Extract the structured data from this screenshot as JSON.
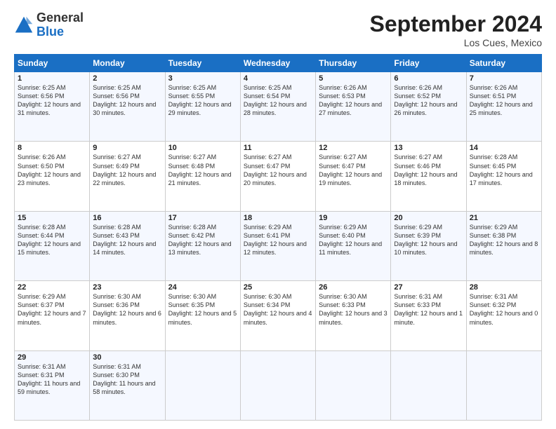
{
  "header": {
    "logo_general": "General",
    "logo_blue": "Blue",
    "month_title": "September 2024",
    "location": "Los Cues, Mexico"
  },
  "days_of_week": [
    "Sunday",
    "Monday",
    "Tuesday",
    "Wednesday",
    "Thursday",
    "Friday",
    "Saturday"
  ],
  "weeks": [
    [
      {
        "num": "1",
        "sunrise": "6:25 AM",
        "sunset": "6:56 PM",
        "daylight": "12 hours and 31 minutes."
      },
      {
        "num": "2",
        "sunrise": "6:25 AM",
        "sunset": "6:56 PM",
        "daylight": "12 hours and 30 minutes."
      },
      {
        "num": "3",
        "sunrise": "6:25 AM",
        "sunset": "6:55 PM",
        "daylight": "12 hours and 29 minutes."
      },
      {
        "num": "4",
        "sunrise": "6:25 AM",
        "sunset": "6:54 PM",
        "daylight": "12 hours and 28 minutes."
      },
      {
        "num": "5",
        "sunrise": "6:26 AM",
        "sunset": "6:53 PM",
        "daylight": "12 hours and 27 minutes."
      },
      {
        "num": "6",
        "sunrise": "6:26 AM",
        "sunset": "6:52 PM",
        "daylight": "12 hours and 26 minutes."
      },
      {
        "num": "7",
        "sunrise": "6:26 AM",
        "sunset": "6:51 PM",
        "daylight": "12 hours and 25 minutes."
      }
    ],
    [
      {
        "num": "8",
        "sunrise": "6:26 AM",
        "sunset": "6:50 PM",
        "daylight": "12 hours and 23 minutes."
      },
      {
        "num": "9",
        "sunrise": "6:27 AM",
        "sunset": "6:49 PM",
        "daylight": "12 hours and 22 minutes."
      },
      {
        "num": "10",
        "sunrise": "6:27 AM",
        "sunset": "6:48 PM",
        "daylight": "12 hours and 21 minutes."
      },
      {
        "num": "11",
        "sunrise": "6:27 AM",
        "sunset": "6:47 PM",
        "daylight": "12 hours and 20 minutes."
      },
      {
        "num": "12",
        "sunrise": "6:27 AM",
        "sunset": "6:47 PM",
        "daylight": "12 hours and 19 minutes."
      },
      {
        "num": "13",
        "sunrise": "6:27 AM",
        "sunset": "6:46 PM",
        "daylight": "12 hours and 18 minutes."
      },
      {
        "num": "14",
        "sunrise": "6:28 AM",
        "sunset": "6:45 PM",
        "daylight": "12 hours and 17 minutes."
      }
    ],
    [
      {
        "num": "15",
        "sunrise": "6:28 AM",
        "sunset": "6:44 PM",
        "daylight": "12 hours and 15 minutes."
      },
      {
        "num": "16",
        "sunrise": "6:28 AM",
        "sunset": "6:43 PM",
        "daylight": "12 hours and 14 minutes."
      },
      {
        "num": "17",
        "sunrise": "6:28 AM",
        "sunset": "6:42 PM",
        "daylight": "12 hours and 13 minutes."
      },
      {
        "num": "18",
        "sunrise": "6:29 AM",
        "sunset": "6:41 PM",
        "daylight": "12 hours and 12 minutes."
      },
      {
        "num": "19",
        "sunrise": "6:29 AM",
        "sunset": "6:40 PM",
        "daylight": "12 hours and 11 minutes."
      },
      {
        "num": "20",
        "sunrise": "6:29 AM",
        "sunset": "6:39 PM",
        "daylight": "12 hours and 10 minutes."
      },
      {
        "num": "21",
        "sunrise": "6:29 AM",
        "sunset": "6:38 PM",
        "daylight": "12 hours and 8 minutes."
      }
    ],
    [
      {
        "num": "22",
        "sunrise": "6:29 AM",
        "sunset": "6:37 PM",
        "daylight": "12 hours and 7 minutes."
      },
      {
        "num": "23",
        "sunrise": "6:30 AM",
        "sunset": "6:36 PM",
        "daylight": "12 hours and 6 minutes."
      },
      {
        "num": "24",
        "sunrise": "6:30 AM",
        "sunset": "6:35 PM",
        "daylight": "12 hours and 5 minutes."
      },
      {
        "num": "25",
        "sunrise": "6:30 AM",
        "sunset": "6:34 PM",
        "daylight": "12 hours and 4 minutes."
      },
      {
        "num": "26",
        "sunrise": "6:30 AM",
        "sunset": "6:33 PM",
        "daylight": "12 hours and 3 minutes."
      },
      {
        "num": "27",
        "sunrise": "6:31 AM",
        "sunset": "6:33 PM",
        "daylight": "12 hours and 1 minute."
      },
      {
        "num": "28",
        "sunrise": "6:31 AM",
        "sunset": "6:32 PM",
        "daylight": "12 hours and 0 minutes."
      }
    ],
    [
      {
        "num": "29",
        "sunrise": "6:31 AM",
        "sunset": "6:31 PM",
        "daylight": "11 hours and 59 minutes."
      },
      {
        "num": "30",
        "sunrise": "6:31 AM",
        "sunset": "6:30 PM",
        "daylight": "11 hours and 58 minutes."
      },
      null,
      null,
      null,
      null,
      null
    ]
  ]
}
